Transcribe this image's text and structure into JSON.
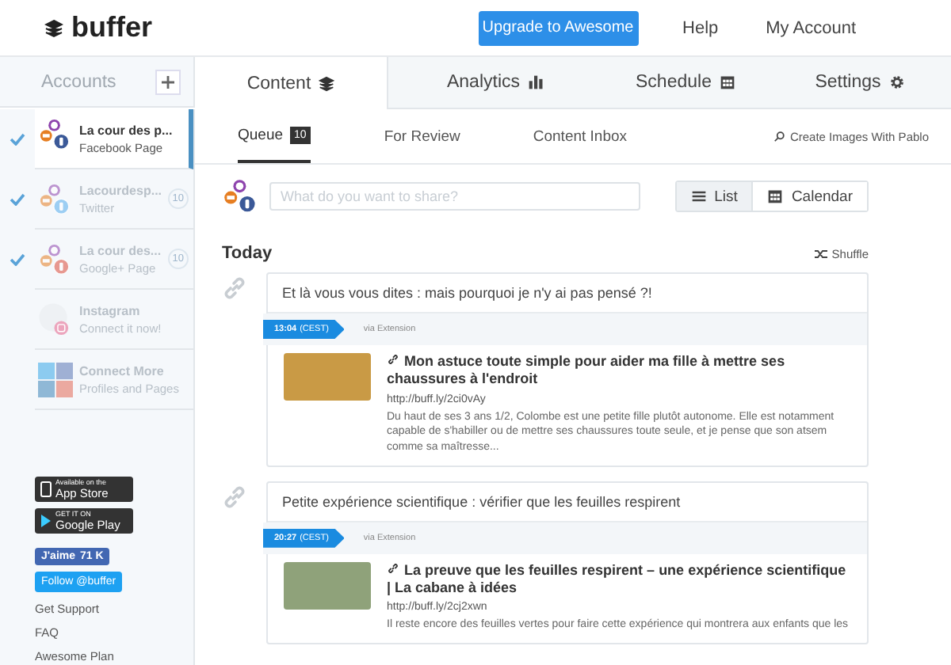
{
  "header": {
    "logo": "buffer",
    "upgrade_button": "Upgrade to Awesome",
    "links": [
      "Help",
      "My Account"
    ]
  },
  "accounts_heading": "Accounts",
  "accounts": [
    {
      "name": "La cour des p...",
      "subtitle": "Facebook Page",
      "kind": "facebook",
      "checked": true,
      "selected": true
    },
    {
      "name": "Lacourdesp...",
      "subtitle": "Twitter",
      "kind": "twitter",
      "checked": true,
      "selected": false,
      "count": "10"
    },
    {
      "name": "La cour des...",
      "subtitle": "Google+ Page",
      "kind": "googleplus",
      "checked": true,
      "selected": false,
      "count": "10"
    },
    {
      "name": "Instagram",
      "subtitle": "Connect it now!",
      "kind": "instagram",
      "checked": false,
      "selected": false
    },
    {
      "name": "Connect More",
      "subtitle": "Profiles and Pages",
      "kind": "more",
      "checked": false,
      "selected": false
    }
  ],
  "store_badges": [
    {
      "kind": "apple",
      "small": "Available on the",
      "big": "App Store"
    },
    {
      "kind": "google",
      "small": "GET IT ON",
      "big": "Google Play"
    }
  ],
  "like_button": {
    "label": "J'aime",
    "count": "71 K"
  },
  "follow_button": "Follow @buffer",
  "footer_links": [
    "Get Support",
    "FAQ",
    "Awesome Plan"
  ],
  "tabs": [
    {
      "label": "Content",
      "selected": true
    },
    {
      "label": "Analytics",
      "selected": false
    },
    {
      "label": "Schedule",
      "selected": false
    },
    {
      "label": "Settings",
      "selected": false
    }
  ],
  "subtabs": [
    {
      "label": "Queue",
      "badge": "10",
      "selected": true
    },
    {
      "label": "For Review",
      "selected": false
    },
    {
      "label": "Content Inbox",
      "selected": false
    }
  ],
  "pablo_link": "Create Images With Pablo",
  "composer": {
    "placeholder": "What do you want to share?"
  },
  "view_toggle": [
    {
      "label": "List",
      "selected": true
    },
    {
      "label": "Calendar",
      "selected": false
    }
  ],
  "day_heading": "Today",
  "shuffle": "Shuffle",
  "posts": [
    {
      "text": "Et là vous vous dites : mais pourquoi je n'y ai pas pensé ?!",
      "time": "13:04",
      "zone": "(CEST)",
      "via": "via Extension",
      "link_title": "Mon astuce toute simple pour aider ma fille à mettre ses chaussures à l'endroit",
      "url": "http://buff.ly/2ci0vAy",
      "description": "Du haut de ses 3 ans 1/2, Colombe est une petite fille plutôt autonome. Elle est notamment capable de s'habiller ou de mettre ses chaussures toute seule, et je pense que son atsem comme sa maîtresse..."
    },
    {
      "text": "Petite expérience scientifique : vérifier que les feuilles respirent",
      "time": "20:27",
      "zone": "(CEST)",
      "via": "via Extension",
      "link_title": "La preuve que les feuilles respirent – une expérience scientifique | La cabane à idées",
      "url": "http://buff.ly/2cj2xwn",
      "description": "Il reste encore des feuilles vertes pour faire cette expérience qui montrera aux enfants que les"
    }
  ]
}
